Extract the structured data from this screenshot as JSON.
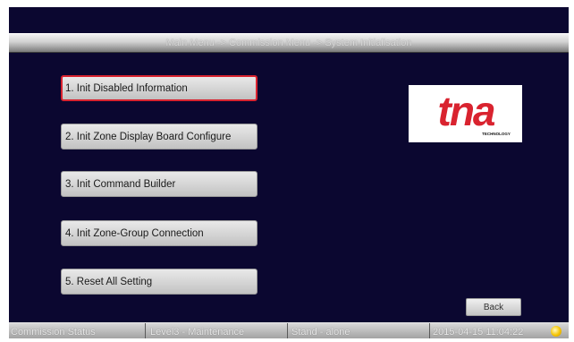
{
  "header": {
    "breadcrumb": "Main Menu -> Commission Menu -> System Initialisation"
  },
  "menu": {
    "items": [
      {
        "label": "1. Init Disabled Information",
        "selected": true
      },
      {
        "label": "2. Init Zone Display Board Configure",
        "selected": false
      },
      {
        "label": "3. Init Command Builder",
        "selected": false
      },
      {
        "label": "4. Init Zone-Group Connection",
        "selected": false
      },
      {
        "label": "5. Reset All Setting",
        "selected": false
      }
    ]
  },
  "logo": {
    "brand": "tna",
    "tagline": "TECHNOLOGY",
    "brand_color": "#d9232f"
  },
  "buttons": {
    "back_label": "Back"
  },
  "status_bar": {
    "mode": "Commission Status",
    "access_level": "Level3 - Maintenance",
    "system_type": "Stand - alone",
    "datetime": "2015-04-15 11:04:22",
    "indicator_color": "#f5c400"
  },
  "colors": {
    "screen_background": "#0b0730",
    "selection_border": "#d9232f"
  }
}
